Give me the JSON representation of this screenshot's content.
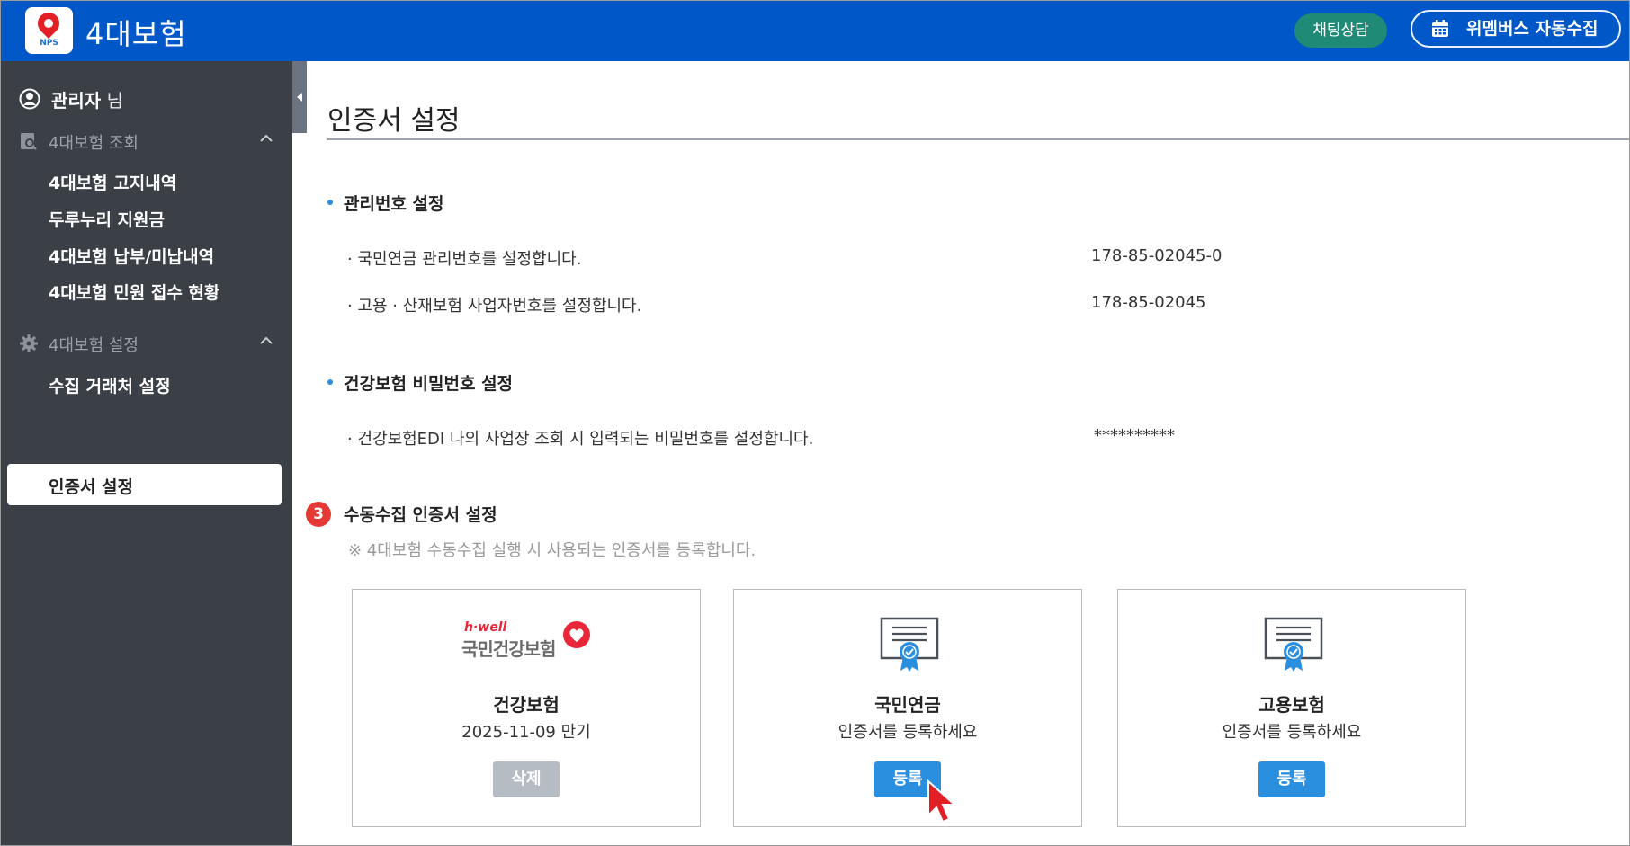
{
  "header": {
    "app_title": "4대보험",
    "logo_text": "NPS",
    "chat_button": "채팅상담",
    "auto_collect_button": "위멤버스 자동수집",
    "colors": {
      "bar": "#0058c8",
      "chat": "#1f8a75"
    }
  },
  "sidebar": {
    "user_name": "관리자",
    "user_suffix": " 님",
    "sections": [
      {
        "label": "4대보험 조회",
        "icon": "search-doc-icon",
        "items": [
          "4대보험 고지내역",
          "두루누리 지원금",
          "4대보험 납부/미납내역",
          "4대보험 민원 접수 현황"
        ]
      },
      {
        "label": "4대보험 설정",
        "icon": "gear-icon",
        "items": [
          "수집 거래처 설정",
          "인증서 설정"
        ]
      }
    ],
    "active_item": "인증서 설정"
  },
  "main": {
    "page_title": "인증서 설정",
    "management": {
      "title": "관리번호 설정",
      "rows": [
        {
          "desc": "· 국민연금 관리번호를 설정합니다.",
          "value": "178-85-02045-0"
        },
        {
          "desc": "· 고용 · 산재보험 사업자번호를 설정합니다.",
          "value": "178-85-02045"
        }
      ]
    },
    "health_password": {
      "title": "건강보험 비밀번호 설정",
      "desc": "· 건강보험EDI 나의 사업장 조회 시 입력되는 비밀번호를 설정합니다.",
      "value": "**********"
    },
    "manual_cert": {
      "step": "3",
      "title": "수동수집 인증서 설정",
      "note": "※ 4대보험 수동수집 실행 시 사용되는 인증서를 등록합니다.",
      "cards": [
        {
          "name": "건강보험",
          "status": "2025-11-09 만기",
          "button": "삭제",
          "logo_top": "h·well",
          "logo_main": "국민건강보험"
        },
        {
          "name": "국민연금",
          "status": "인증서를 등록하세요",
          "button": "등록"
        },
        {
          "name": "고용보험",
          "status": "인증서를 등록하세요",
          "button": "등록"
        }
      ]
    }
  }
}
